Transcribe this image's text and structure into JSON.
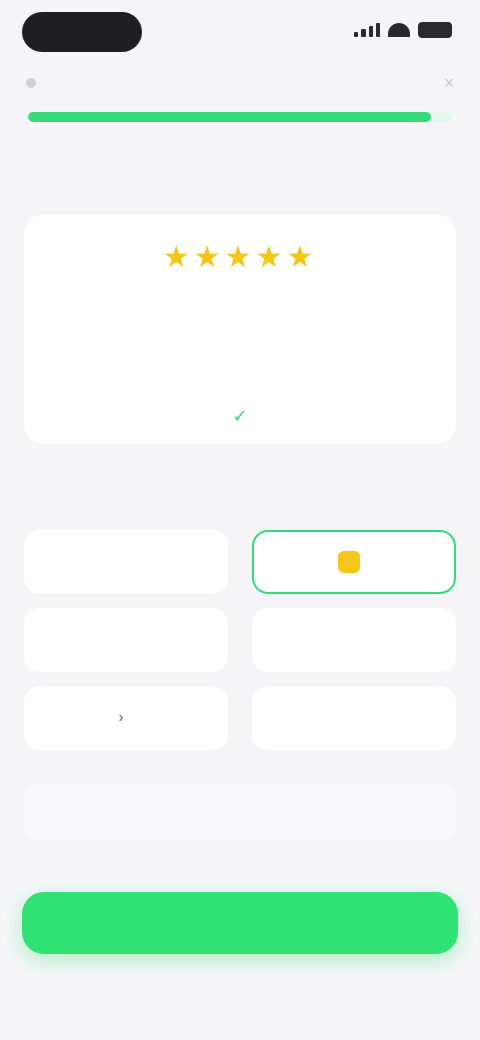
{
  "header": {
    "close_glyph": "×",
    "progress_percent": 95
  },
  "progress": {
    "text_prefix": "",
    "text_highlight": "",
    "subtext": ""
  },
  "review": {
    "stars": "★★★★★",
    "text": "",
    "reviewer": "",
    "verified_glyph": "✓"
  },
  "section_title": "",
  "options": [
    {
      "label": "",
      "icon": ""
    },
    {
      "label": "",
      "icon": "gold-square-icon"
    },
    {
      "label": "",
      "icon": ""
    },
    {
      "label": "",
      "icon": ""
    },
    {
      "label": "",
      "icon": "arrow-icon"
    },
    {
      "label": "",
      "icon": ""
    }
  ],
  "compare": {
    "left": "",
    "right": ""
  },
  "fine_print": "",
  "cta_label": "",
  "colors": {
    "accent_green": "#2fe273",
    "progress_green": "#35d97a",
    "star_gold": "#f5c518",
    "link_blue": "#3a7be0"
  }
}
